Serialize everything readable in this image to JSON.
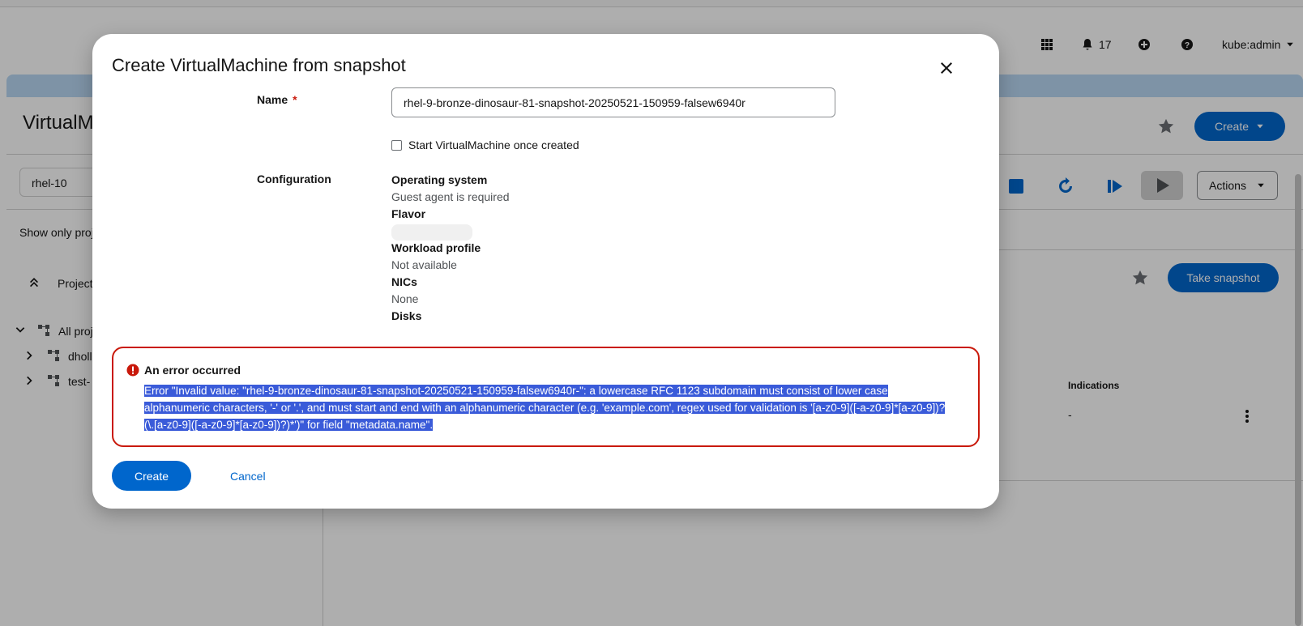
{
  "masthead": {
    "notification_count": "17",
    "user": "kube:admin"
  },
  "background": {
    "page_title": "VirtualM",
    "create_label": "Create",
    "search_value": "rhel-10",
    "show_only_label": "Show only proj",
    "projects_header": "Project",
    "tree": [
      "All proj",
      "dholl",
      "test-"
    ],
    "actions_label": "Actions",
    "take_snapshot_label": "Take snapshot",
    "indications_header": "Indications",
    "indications_value": "-"
  },
  "modal": {
    "title": "Create VirtualMachine from snapshot",
    "name_label": "Name",
    "required_marker": "*",
    "name_value": "rhel-9-bronze-dinosaur-81-snapshot-20250521-150959-falsew6940r",
    "start_checkbox_label": "Start VirtualMachine once created",
    "configuration_label": "Configuration",
    "configuration": {
      "os_label": "Operating system",
      "os_value": "Guest agent is required",
      "flavor_label": "Flavor",
      "workload_label": "Workload profile",
      "workload_value": "Not available",
      "nics_label": "NICs",
      "nics_value": "None",
      "disks_label": "Disks"
    },
    "alert": {
      "title": "An error occurred",
      "message": "Error \"Invalid value: \"rhel-9-bronze-dinosaur-81-snapshot-20250521-150959-falsew6940r-\": a lowercase RFC 1123 subdomain must consist of lower case alphanumeric characters, '-' or '.', and must start and end with an alphanumeric character (e.g. 'example.com', regex used for validation is '[a-z0-9]([-a-z0-9]*[a-z0-9])?(\\.[a-z0-9]([-a-z0-9]*[a-z0-9])?)*')\" for field \"metadata.name\"."
    },
    "create_label": "Create",
    "cancel_label": "Cancel"
  },
  "colors": {
    "primary": "#0066cc",
    "danger": "#c9190b",
    "selection": "#3a5bd9"
  }
}
